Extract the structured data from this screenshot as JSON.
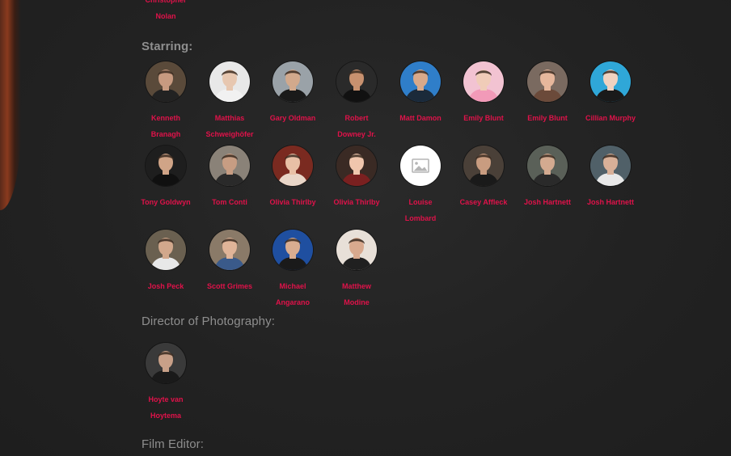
{
  "director": {
    "name_line1": "Christopher",
    "name_line2": "Nolan"
  },
  "sections": {
    "starring": "Starring:",
    "photography": "Director of Photography:",
    "editor": "Film Editor:"
  },
  "cast": [
    {
      "line1": "Kenneth",
      "line2": "Branagh",
      "icon": "portrait",
      "bg": "#5a4a3a",
      "skin": "#c79a80",
      "shirt": "#222"
    },
    {
      "line1": "Matthias",
      "line2": "Schweighöfer",
      "icon": "portrait",
      "bg": "#e8e8e8",
      "skin": "#e7c7b0",
      "shirt": "#f1f1f1"
    },
    {
      "line1": "Gary Oldman",
      "line2": "",
      "icon": "portrait",
      "bg": "#9aa2a8",
      "skin": "#d2a98c",
      "shirt": "#1a1a1a"
    },
    {
      "line1": "Robert",
      "line2": "Downey Jr.",
      "icon": "portrait",
      "bg": "#2a2a2a",
      "skin": "#c8916f",
      "shirt": "#111"
    },
    {
      "line1": "Matt Damon",
      "line2": "",
      "icon": "portrait",
      "bg": "#2f7ec9",
      "skin": "#d9a98a",
      "shirt": "#1b2a3a"
    },
    {
      "line1": "Emily Blunt",
      "line2": "",
      "icon": "portrait",
      "bg": "#f2c3d2",
      "skin": "#f0ccb8",
      "shirt": "#f29ab8"
    },
    {
      "line1": "Emily Blunt",
      "line2": "",
      "icon": "portrait",
      "bg": "#7a6a60",
      "skin": "#e6b79c",
      "shirt": "#6b4a3a"
    },
    {
      "line1": "Cillian Murphy",
      "line2": "",
      "icon": "portrait",
      "bg": "#2fa7d8",
      "skin": "#f0d2c0",
      "shirt": "#1a1a1a"
    },
    {
      "line1": "Tony Goldwyn",
      "line2": "",
      "icon": "portrait",
      "bg": "#1e1e1e",
      "skin": "#d0a487",
      "shirt": "#101010"
    },
    {
      "line1": "Tom Conti",
      "line2": "",
      "icon": "portrait",
      "bg": "#8a8278",
      "skin": "#c79d83",
      "shirt": "#2a2a2a"
    },
    {
      "line1": "Olivia Thirlby",
      "line2": "",
      "icon": "portrait",
      "bg": "#7a2a20",
      "skin": "#e8c0a6",
      "shirt": "#e9d6c8"
    },
    {
      "line1": "Olivia Thirlby",
      "line2": "",
      "icon": "portrait",
      "bg": "#3a2a24",
      "skin": "#f0c6ad",
      "shirt": "#7a2020"
    },
    {
      "line1": "Louise",
      "line2": "Lombard",
      "icon": "image-placeholder",
      "bg": "#ffffff",
      "skin": "",
      "shirt": ""
    },
    {
      "line1": "Casey Affleck",
      "line2": "",
      "icon": "portrait",
      "bg": "#4a4038",
      "skin": "#c99c80",
      "shirt": "#1a1a1a"
    },
    {
      "line1": "Josh Hartnett",
      "line2": "",
      "icon": "portrait",
      "bg": "#5a6058",
      "skin": "#d3aa90",
      "shirt": "#2a2a2a"
    },
    {
      "line1": "Josh Hartnett",
      "line2": "",
      "icon": "portrait",
      "bg": "#506068",
      "skin": "#d8b098",
      "shirt": "#e8e8e8"
    },
    {
      "line1": "Josh Peck",
      "line2": "",
      "icon": "portrait",
      "bg": "#6a6050",
      "skin": "#d2a88c",
      "shirt": "#e8e8e8"
    },
    {
      "line1": "Scott Grimes",
      "line2": "",
      "icon": "portrait",
      "bg": "#8a7a68",
      "skin": "#e0b498",
      "shirt": "#3a5a8a"
    },
    {
      "line1": "Michael",
      "line2": "Angarano",
      "icon": "portrait",
      "bg": "#1f4fa0",
      "skin": "#d9ad90",
      "shirt": "#1a1a1a"
    },
    {
      "line1": "Matthew",
      "line2": "Modine",
      "icon": "portrait",
      "bg": "#e8e0d8",
      "skin": "#d8a98e",
      "shirt": "#202020"
    }
  ],
  "photography": [
    {
      "line1": "Hoyte van",
      "line2": "Hoytema",
      "icon": "portrait",
      "bg": "#3a3a3a",
      "skin": "#c8a088",
      "shirt": "#1a1a1a"
    }
  ]
}
